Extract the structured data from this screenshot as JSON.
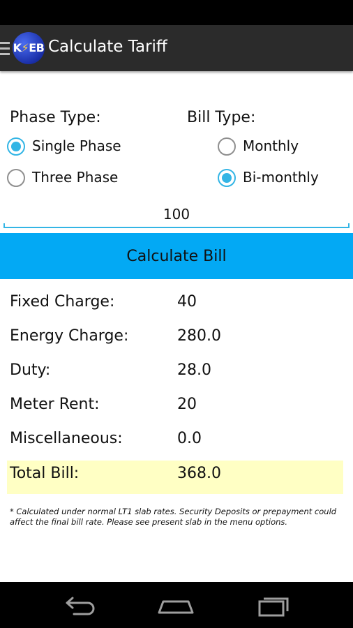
{
  "app": {
    "title": "Calculate Tariff",
    "logo_text": "K",
    "logo_bolt": "⚡",
    "logo_suffix": "EB"
  },
  "form": {
    "phase_label": "Phase Type:",
    "bill_label": "Bill Type:",
    "phase_options": [
      {
        "label": "Single Phase",
        "checked": true
      },
      {
        "label": "Three Phase",
        "checked": false
      }
    ],
    "bill_options": [
      {
        "label": "Monthly",
        "checked": false
      },
      {
        "label": "Bi-monthly",
        "checked": true
      }
    ],
    "units_value": "100",
    "calculate_label": "Calculate Bill"
  },
  "results": {
    "fixed_label": "Fixed Charge:",
    "fixed_value": "40",
    "energy_label": "Energy Charge:",
    "energy_value": "280.0",
    "duty_label": "Duty:",
    "duty_value": "28.0",
    "meter_label": "Meter Rent:",
    "meter_value": "20",
    "misc_label": "Miscellaneous:",
    "misc_value": "0.0",
    "total_label": "Total Bill:",
    "total_value": "368.0"
  },
  "footnote": "* Calculated under normal LT1 slab rates. Security Deposits or prepayment could affect the final bill rate. Please see present slab in the menu options.",
  "colors": {
    "accent": "#33b5e5",
    "button": "#03a9f4",
    "total_highlight": "#ffffc4",
    "action_bar": "#2b2b2b"
  },
  "nav": {
    "icons": [
      "back-icon",
      "home-icon",
      "recent-apps-icon"
    ]
  }
}
